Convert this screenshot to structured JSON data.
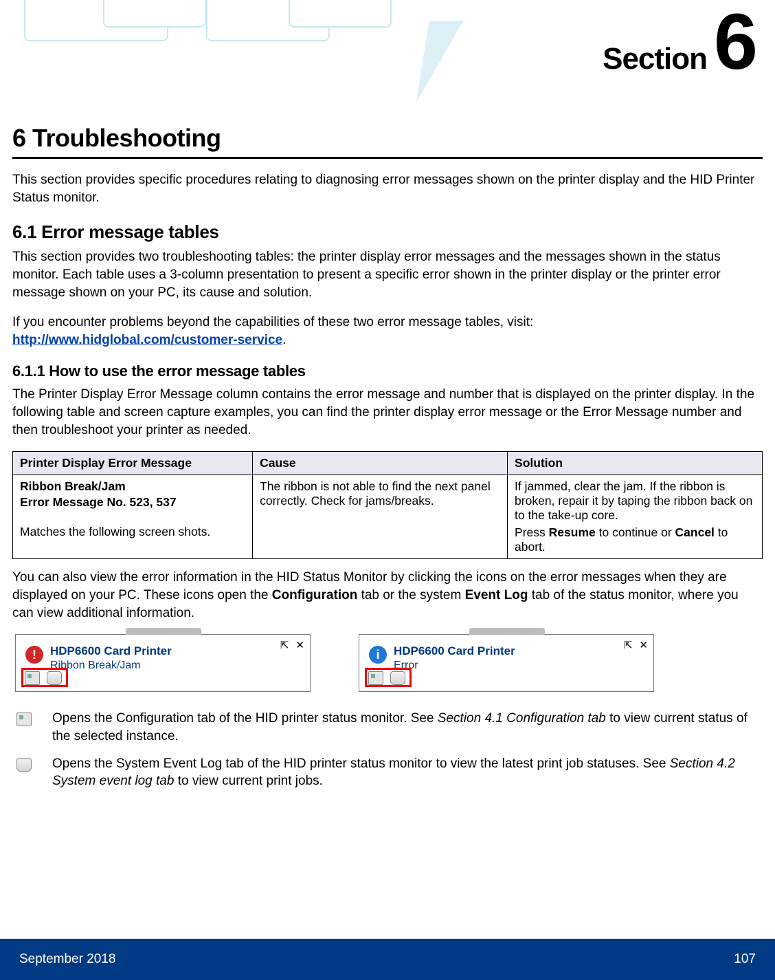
{
  "header": {
    "section_word": "Section",
    "section_number": "6"
  },
  "title": {
    "number": "6",
    "text": "Troubleshooting"
  },
  "intro": "This section provides specific procedures relating to diagnosing error messages shown on the printer display and the HID Printer Status monitor.",
  "sec61": {
    "heading": "6.1 Error message tables",
    "para1": "This section provides two troubleshooting tables: the printer display error messages and the messages shown in the status monitor. Each table uses a 3-column presentation to present a specific error shown in the printer display or the printer error message shown on your PC, its cause and solution.",
    "para2_pre": "If you encounter problems beyond the capabilities of these two error message tables, visit: ",
    "link_text": "http://www.hidglobal.com/customer-service",
    "para2_post": "."
  },
  "sec611": {
    "heading": "6.1.1 How to use the error message tables",
    "para": "The Printer Display Error Message column contains the error message and number that is displayed on the printer display. In the following table and screen capture examples, you can find the printer display error message or the Error Message number and then troubleshoot your printer as needed."
  },
  "table": {
    "headers": {
      "c1": "Printer Display Error Message",
      "c2": "Cause",
      "c3": "Solution"
    },
    "row": {
      "c1_primary": "Ribbon Break/Jam",
      "c1_secondary": "Error Message No. 523, 537",
      "c1_tertiary": "Matches the following screen shots.",
      "c2": "The ribbon is not able to find the next panel correctly. Check for jams/breaks.",
      "c3_line1": "If jammed, clear the jam. If the ribbon is broken, repair it by taping the ribbon back on to the take-up core.",
      "c3_line2_pre": "Press ",
      "c3_line2_b1": "Resume",
      "c3_line2_mid": " to continue or ",
      "c3_line2_b2": "Cancel",
      "c3_line2_post": " to abort."
    }
  },
  "after_table": {
    "pre": "You can also view the error information in the HID Status Monitor by clicking the icons on the error messages when they are displayed on your PC. These icons open the ",
    "b1": "Configuration",
    "mid": " tab or the system ",
    "b2": "Event Log",
    "post": " tab of the status monitor, where you can view additional information."
  },
  "popups": {
    "left": {
      "title": "HDP6600 Card Printer",
      "subtitle": "Ribbon Break/Jam"
    },
    "right": {
      "title": "HDP6600 Card Printer",
      "subtitle": "Error"
    },
    "pin": "⇱",
    "close": "✕"
  },
  "legend": {
    "item1_pre": "Opens the Configuration tab of the HID printer status monitor. See ",
    "item1_ital": "Section 4.1 Configuration tab",
    "item1_post": " to view current status of the selected instance.",
    "item2_pre": "Opens the System Event Log tab of the HID printer status monitor to view the latest print job statuses. See ",
    "item2_ital": "Section 4.2 System event log tab",
    "item2_post": " to view current print jobs."
  },
  "footer": {
    "date": "September 2018",
    "page": "107"
  }
}
